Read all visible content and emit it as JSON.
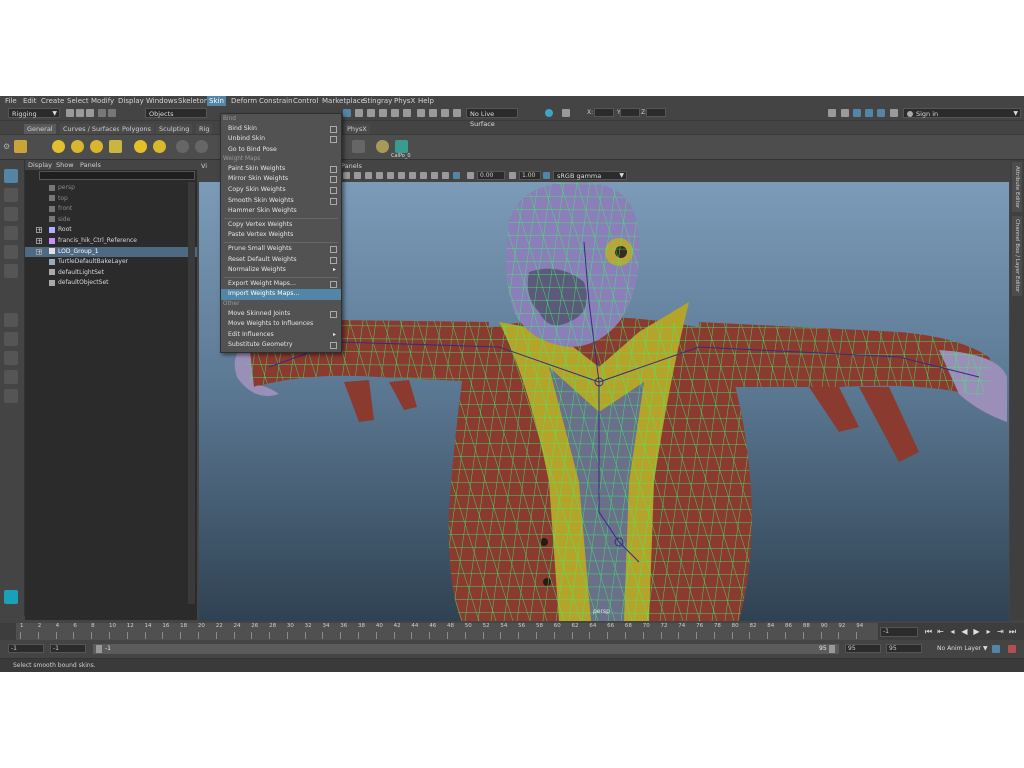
{
  "menubar": {
    "items": [
      "File",
      "Edit",
      "Create",
      "Select",
      "Modify",
      "Display",
      "Windows",
      "Skeleton",
      "Skin",
      "Deform",
      "Constrain",
      "Control",
      "Marketplace",
      "Stingray",
      "PhysX",
      "Help"
    ],
    "active": "Skin"
  },
  "statusline": {
    "workspace": "Rigging",
    "selection_mode": "Objects",
    "live_surface": "No Live Surface",
    "sign_in": "Sign in",
    "xyz": [
      "X:",
      "Y:",
      "Z:"
    ]
  },
  "shelf": {
    "tabs": [
      "General",
      "Curves / Surfaces",
      "Polygons",
      "Sculpting",
      "Rig",
      "PhysX"
    ],
    "extra_label": "CalPo_0"
  },
  "outliner": {
    "menu": [
      "Display",
      "Show",
      "Panels"
    ],
    "rows": [
      {
        "label": "persp",
        "dim": true,
        "expand": false
      },
      {
        "label": "top",
        "dim": true,
        "expand": false
      },
      {
        "label": "front",
        "dim": true,
        "expand": false
      },
      {
        "label": "side",
        "dim": true,
        "expand": false
      },
      {
        "label": "Root",
        "dim": false,
        "expand": true
      },
      {
        "label": "francis_hik_Ctrl_Reference",
        "dim": false,
        "expand": true
      },
      {
        "label": "LOD_Group_1",
        "dim": false,
        "expand": true,
        "selected": true
      },
      {
        "label": "TurtleDefaultBakeLayer",
        "dim": false,
        "expand": false
      },
      {
        "label": "defaultLightSet",
        "dim": false,
        "expand": false
      },
      {
        "label": "defaultObjectSet",
        "dim": false,
        "expand": false
      }
    ]
  },
  "viewport": {
    "menu_visible": [
      "Vi",
      "Panels"
    ],
    "exposure": "0.00",
    "gamma": "1.00",
    "color_space": "sRGB gamma",
    "camera_label": "persp"
  },
  "skin_menu": {
    "items": [
      {
        "type": "section",
        "label": "Bind"
      },
      {
        "type": "item",
        "label": "Bind Skin",
        "box": true
      },
      {
        "type": "item",
        "label": "Unbind Skin",
        "box": true
      },
      {
        "type": "item",
        "label": "Go to Bind Pose"
      },
      {
        "type": "section",
        "label": "Weight Maps"
      },
      {
        "type": "item",
        "label": "Paint Skin Weights",
        "box": true
      },
      {
        "type": "item",
        "label": "Mirror Skin Weights",
        "box": true
      },
      {
        "type": "item",
        "label": "Copy Skin Weights",
        "box": true
      },
      {
        "type": "item",
        "label": "Smooth Skin Weights",
        "box": true
      },
      {
        "type": "item",
        "label": "Hammer Skin Weights"
      },
      {
        "type": "sep"
      },
      {
        "type": "item",
        "label": "Copy Vertex Weights"
      },
      {
        "type": "item",
        "label": "Paste Vertex Weights"
      },
      {
        "type": "sep"
      },
      {
        "type": "item",
        "label": "Prune Small Weights",
        "box": true
      },
      {
        "type": "item",
        "label": "Reset Default Weights",
        "box": true
      },
      {
        "type": "item",
        "label": "Normalize Weights",
        "sub": true
      },
      {
        "type": "sep"
      },
      {
        "type": "item",
        "label": "Export Weight Maps...",
        "box": true
      },
      {
        "type": "item",
        "label": "Import Weights Maps...",
        "highlight": true
      },
      {
        "type": "section",
        "label": "Other"
      },
      {
        "type": "item",
        "label": "Move Skinned Joints",
        "box": true
      },
      {
        "type": "item",
        "label": "Move Weights to Influences"
      },
      {
        "type": "item",
        "label": "Edit Influences",
        "sub": true
      },
      {
        "type": "item",
        "label": "Substitute Geometry",
        "box": true
      }
    ]
  },
  "right_tabs": [
    "Attribute Editor",
    "Channel Box / Layer Editor"
  ],
  "timeslider": {
    "ticks": [
      "1",
      "2",
      "4",
      "6",
      "8",
      "10",
      "12",
      "14",
      "16",
      "18",
      "20",
      "22",
      "24",
      "26",
      "28",
      "30",
      "32",
      "34",
      "36",
      "38",
      "40",
      "42",
      "44",
      "46",
      "48",
      "50",
      "52",
      "54",
      "56",
      "58",
      "60",
      "62",
      "64",
      "66",
      "68",
      "70",
      "72",
      "74",
      "76",
      "78",
      "80",
      "82",
      "84",
      "86",
      "88",
      "90",
      "92",
      "94"
    ],
    "current_frame": "-1",
    "frame_end": "95"
  },
  "rangebar": {
    "start": "-1",
    "start_inner": "-1",
    "range_start": "-1",
    "range_end": "95",
    "end_inner": "95",
    "end": "95",
    "anim_layer": "No Anim Layer"
  },
  "helpline": {
    "text": "Select smooth bound skins."
  },
  "colors": {
    "accent": "#5285a6",
    "mesh": "#3cf06e",
    "body_red": "#8b3a30",
    "vest_yellow": "#b4a52a",
    "head_purple": "#8a7fb8"
  }
}
